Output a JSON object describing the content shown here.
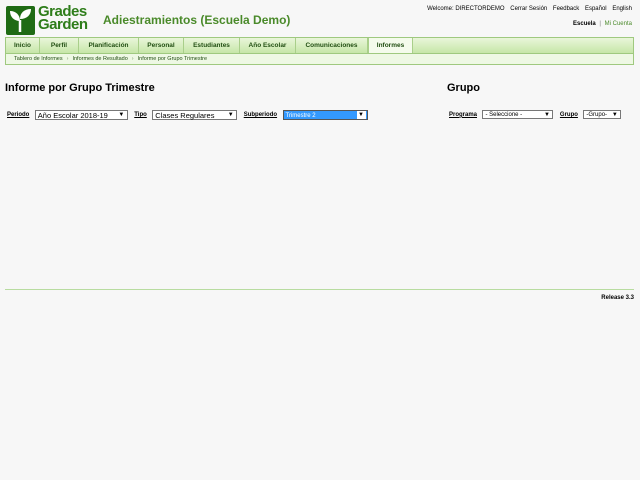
{
  "header": {
    "logo_line1": "Grades",
    "logo_line2": "Garden",
    "school_title": "Adiestramientos (Escuela Demo)",
    "top_links": {
      "welcome": "Welcome: DIRECTORDEMO",
      "logout": "Cerrar Sesión",
      "feedback": "Feedback",
      "spanish": "Español",
      "english": "English"
    },
    "switcher": {
      "school": "Escuela",
      "separator": "|",
      "account": "Mi Cuenta"
    }
  },
  "nav": {
    "items": [
      {
        "label": "Inicio"
      },
      {
        "label": "Perfil"
      },
      {
        "label": "Planificación"
      },
      {
        "label": "Personal"
      },
      {
        "label": "Estudiantes"
      },
      {
        "label": "Año Escolar"
      },
      {
        "label": "Comunicaciones"
      },
      {
        "label": "Informes"
      }
    ],
    "active": "Informes"
  },
  "breadcrumb": [
    "Tablero de Informes",
    "Informes de Resultado",
    "Informe por Grupo Trimestre"
  ],
  "main": {
    "title": "Informe por Grupo Trimestre",
    "filters": {
      "period_label": "Periodo",
      "period_value": "Año Escolar 2018-19",
      "type_label": "Tipo",
      "type_value": "Clases Regulares",
      "subperiod_label": "Subperiodo",
      "subperiod_value": "Trimestre 2"
    }
  },
  "side": {
    "title": "Grupo",
    "program_label": "Programa",
    "program_value": "- Seleccione -",
    "group_label": "Grupo",
    "group_value": "-Grupo-"
  },
  "footer": {
    "release": "Release 3.3"
  },
  "colors": {
    "brand_green": "#2e7d1a",
    "nav_text": "#214e12",
    "selected_option": "#3399ff"
  }
}
